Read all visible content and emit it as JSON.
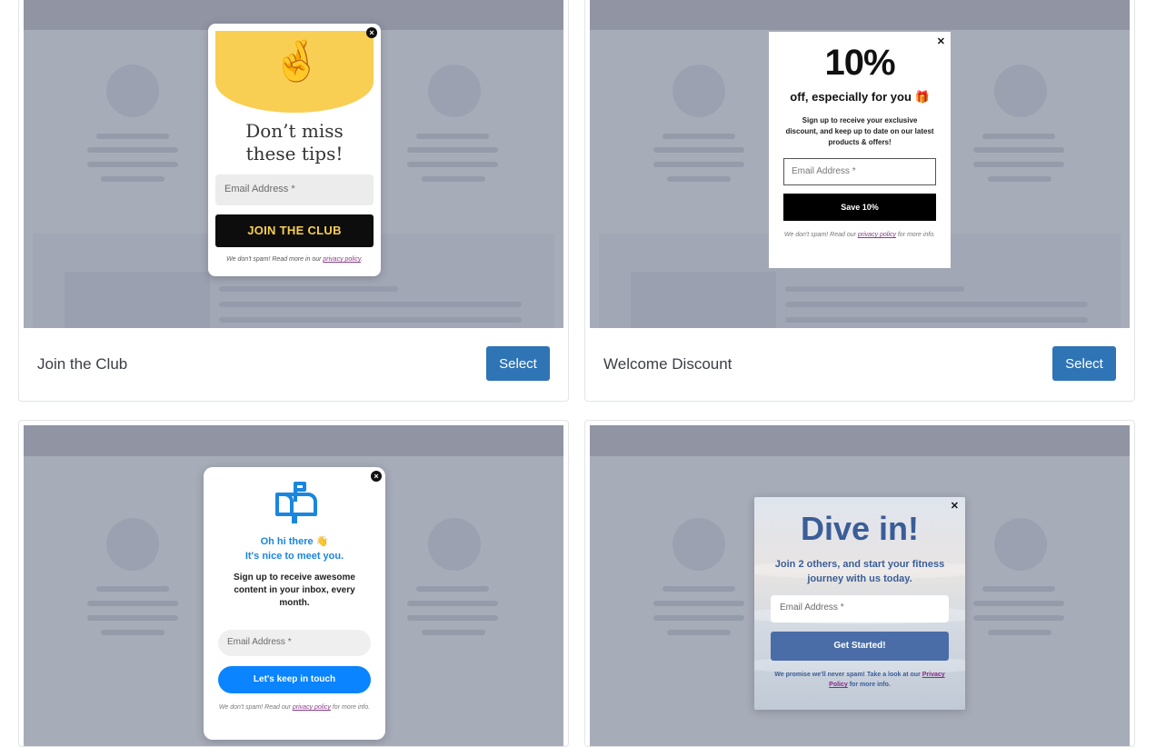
{
  "templates": [
    {
      "title": "Join the Club",
      "select_label": "Select",
      "popup": {
        "emoji": "🤞",
        "headline_line1": "Don’t miss",
        "headline_line2": "these tips!",
        "email_placeholder": "Email Address *",
        "cta": "JOIN THE CLUB",
        "fine_prefix": "We don't spam! Read more in our ",
        "fine_link": "privacy policy",
        "fine_suffix": "."
      }
    },
    {
      "title": "Welcome Discount",
      "select_label": "Select",
      "popup": {
        "big": "10%",
        "subtitle": "off, especially for you 🎁",
        "description": "Sign up to receive your exclusive discount, and keep up to date on our latest products & offers!",
        "email_placeholder": "Email Address *",
        "cta": "Save 10%",
        "fine_prefix": "We don't spam! Read our ",
        "fine_link": "privacy policy",
        "fine_suffix": " for more info."
      }
    },
    {
      "title": "",
      "select_label": "",
      "popup": {
        "greeting_line1": "Oh hi there 👋",
        "greeting_line2": "It's nice to meet you.",
        "description": "Sign up to receive awesome content in your inbox, every month.",
        "email_placeholder": "Email Address *",
        "cta": "Let's keep in touch",
        "fine_prefix": "We don't spam! Read our ",
        "fine_link": "privacy policy",
        "fine_suffix": " for more info."
      }
    },
    {
      "title": "",
      "select_label": "",
      "popup": {
        "big": "Dive in!",
        "subtitle": "Join 2 others, and start your fitness journey with us today.",
        "email_placeholder": "Email Address *",
        "cta": "Get Started!",
        "fine_prefix": "We promise we'll never spam! Take a look at our ",
        "fine_link": "Privacy Policy",
        "fine_suffix": " for more info."
      }
    }
  ],
  "icons": {
    "close": "close-icon",
    "mailbox": "mailbox-icon"
  },
  "colors": {
    "select_button": "#2f74b5",
    "club_yellow": "#f8cf52",
    "touch_blue": "#0a84ff",
    "dive_blue": "#3a5d97"
  }
}
